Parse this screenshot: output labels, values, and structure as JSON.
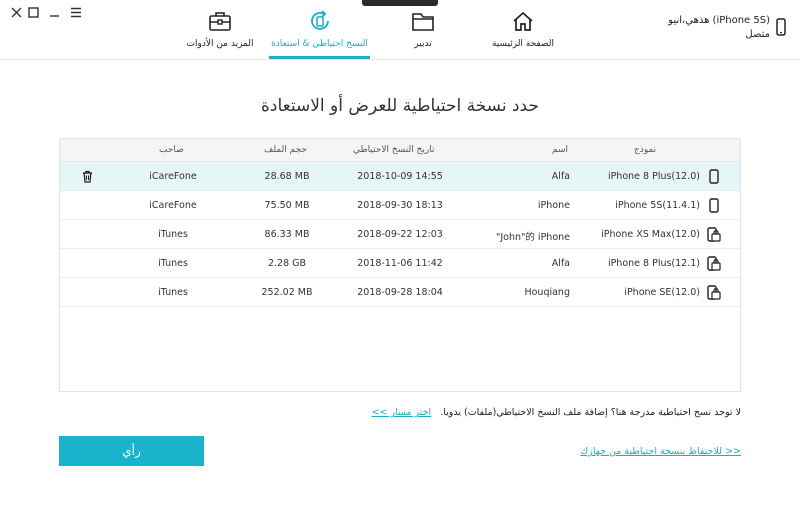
{
  "nav": {
    "home": "الصفحة الرئيسية",
    "manage": "تدبير",
    "backup_restore": "النسخ احتياطي & استعادة",
    "more_tools": "المزيد من الأدوات"
  },
  "device": {
    "name": "هذهي،انيو (iPhone 5S)",
    "status": "متصل"
  },
  "page_title": "حدد نسخة احتياطية للعرض أو الاستعادة",
  "table": {
    "headers": {
      "model": "نموذج",
      "name": "اسم",
      "date": "تاريخ النسخ الاحتياطي",
      "size": "حجم الملف",
      "owner": "صاحب"
    },
    "rows": [
      {
        "model": "iPhone 8 Plus(12.0)",
        "name": "Alfa",
        "date": "2018-10-09 14:55",
        "size": "28.68 MB",
        "owner": "iCareFone",
        "icon": "phone-icon"
      },
      {
        "model": "iPhone 5S(11.4.1)",
        "name": "iPhone",
        "date": "2018-09-30 18:13",
        "size": "75.50 MB",
        "owner": "iCareFone",
        "icon": "phone-icon"
      },
      {
        "model": "iPhone XS Max(12.0)",
        "name": "\"John\"的 iPhone",
        "date": "2018-09-22 12:03",
        "size": "86.33 MB",
        "owner": "iTunes",
        "icon": "locked-phone-icon"
      },
      {
        "model": "iPhone 8 Plus(12.1)",
        "name": "Alfa",
        "date": "2018-11-06 11:42",
        "size": "2.28 GB",
        "owner": "iTunes",
        "icon": "locked-phone-icon"
      },
      {
        "model": "iPhone SE(12.0)",
        "name": "Houqiang",
        "date": "2018-09-28 18:04",
        "size": "252.02 MB",
        "owner": "iTunes",
        "icon": "locked-phone-icon"
      }
    ]
  },
  "note": {
    "text": "لا توجد نسخ احتياطية مدرجة هنا؟ إضافة ملف النسخ الاحتياطي(ملفات) يدويا.",
    "link": "اختر مسار >>"
  },
  "view_button": "رأي",
  "backup_link": "للاحتفاظ بنسخة احتياطية من جهازك >>",
  "colors": {
    "accent": "#19b3cb",
    "selected_row": "#e6f5f8"
  }
}
